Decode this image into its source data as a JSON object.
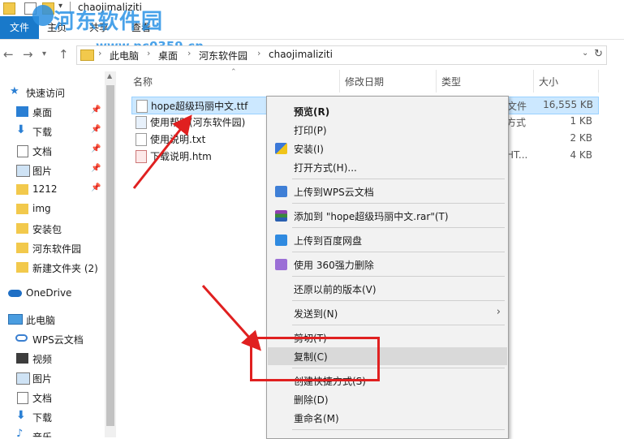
{
  "window": {
    "title": "chaojimaliziti"
  },
  "watermark": {
    "title": "河东软件园",
    "url": "www.pc0359.cn"
  },
  "ribbon": {
    "file": "文件",
    "tabs": [
      "主页",
      "共享",
      "查看"
    ]
  },
  "address": {
    "crumbs": [
      "此电脑",
      "桌面",
      "河东软件园",
      "chaojimaliziti"
    ]
  },
  "nav": {
    "quick_access": "快速访问",
    "items": [
      {
        "label": "桌面",
        "icon": "desktop-icon",
        "pinned": true
      },
      {
        "label": "下载",
        "icon": "download-icon",
        "pinned": true
      },
      {
        "label": "文档",
        "icon": "document-icon",
        "pinned": true
      },
      {
        "label": "图片",
        "icon": "picture-icon",
        "pinned": true
      },
      {
        "label": "1212",
        "icon": "folder-icon",
        "pinned": true
      },
      {
        "label": "img",
        "icon": "folder-icon",
        "pinned": false
      },
      {
        "label": "安装包",
        "icon": "folder-icon",
        "pinned": false
      },
      {
        "label": "河东软件园",
        "icon": "folder-icon",
        "pinned": false
      },
      {
        "label": "新建文件夹 (2)",
        "icon": "folder-icon",
        "pinned": false
      }
    ],
    "onedrive": "OneDrive",
    "this_pc": "此电脑",
    "pc_items": [
      {
        "label": "WPS云文档",
        "icon": "cloud-icon"
      },
      {
        "label": "视频",
        "icon": "video-icon"
      },
      {
        "label": "图片",
        "icon": "picture-icon"
      },
      {
        "label": "文档",
        "icon": "document-icon"
      },
      {
        "label": "下载",
        "icon": "download-icon"
      },
      {
        "label": "音乐",
        "icon": "music-icon"
      }
    ]
  },
  "columns": {
    "name": "名称",
    "modified": "修改日期",
    "type": "类型",
    "size": "大小"
  },
  "files": [
    {
      "name": "hope超级玛丽中文.ttf",
      "type": "文件",
      "size": "16,555 KB",
      "selected": true
    },
    {
      "name": "使用帮助(河东软件园)",
      "type": "方式",
      "size": "1 KB",
      "selected": false
    },
    {
      "name": "使用说明.txt",
      "type": "",
      "size": "2 KB",
      "selected": false
    },
    {
      "name": "下载说明.htm",
      "type": "HT...",
      "size": "4 KB",
      "selected": false
    }
  ],
  "context_menu": {
    "preview": "预览(R)",
    "print": "打印(P)",
    "install": "安装(I)",
    "open_with": "打开方式(H)...",
    "upload_wps": "上传到WPS云文档",
    "add_to_rar": "添加到 \"hope超级玛丽中文.rar\"(T)",
    "upload_baidu": "上传到百度网盘",
    "delete_360": "使用 360强力删除",
    "restore": "还原以前的版本(V)",
    "send_to": "发送到(N)",
    "cut": "剪切(T)",
    "copy": "复制(C)",
    "shortcut": "创建快捷方式(S)",
    "delete": "删除(D)",
    "rename": "重命名(M)"
  },
  "colors": {
    "accent": "#1979ca",
    "selection": "#cce8ff",
    "annotation": "#e02020"
  }
}
